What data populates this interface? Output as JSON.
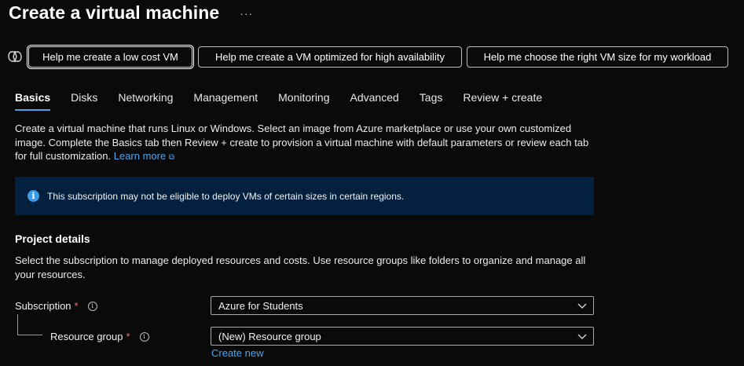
{
  "header": {
    "title": "Create a virtual machine",
    "more_label": "···"
  },
  "copilot": {
    "icon": "copilot-icon",
    "buttons": [
      {
        "label": "Help me create a low cost VM",
        "active": true
      },
      {
        "label": "Help me create a VM optimized for high availability",
        "active": false
      },
      {
        "label": "Help me choose the right VM size for my workload",
        "active": false
      }
    ]
  },
  "tabs": [
    {
      "label": "Basics",
      "active": true
    },
    {
      "label": "Disks"
    },
    {
      "label": "Networking"
    },
    {
      "label": "Management"
    },
    {
      "label": "Monitoring"
    },
    {
      "label": "Advanced"
    },
    {
      "label": "Tags"
    },
    {
      "label": "Review + create"
    }
  ],
  "intro": {
    "text": "Create a virtual machine that runs Linux or Windows. Select an image from Azure marketplace or use your own customized image. Complete the Basics tab then Review + create to provision a virtual machine with default parameters or review each tab for full customization.",
    "link_label": "Learn more"
  },
  "notice": {
    "icon": "info-icon",
    "text": "This subscription may not be eligible to deploy VMs of certain sizes in certain regions."
  },
  "project_details": {
    "title": "Project details",
    "description": "Select the subscription to manage deployed resources and costs. Use resource groups like folders to organize and manage all your resources.",
    "subscription": {
      "label": "Subscription",
      "required_mark": "*",
      "value": "Azure for Students"
    },
    "resource_group": {
      "label": "Resource group",
      "required_mark": "*",
      "value": "(New) Resource group",
      "create_new_label": "Create new"
    }
  },
  "colors": {
    "background": "#0a0a0a",
    "accent": "#4ea1e6",
    "link": "#4ea6f0",
    "notice_bg": "#03203f",
    "required": "#f1707b"
  }
}
